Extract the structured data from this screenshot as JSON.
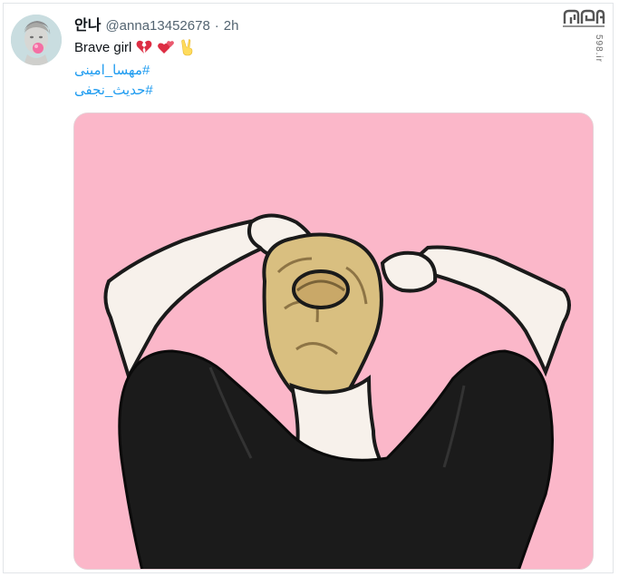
{
  "tweet": {
    "display_name": "안나",
    "handle": "@anna13452678",
    "separator": "·",
    "time": "2h",
    "text": "Brave girl",
    "emojis": [
      "broken-heart",
      "two-hearts",
      "victory-hand"
    ],
    "hashtags": [
      "#مهسا_امینی",
      "#حدیث_نجفی"
    ]
  },
  "watermark": {
    "logo_text": "598",
    "site": "598.ir"
  },
  "media": {
    "description_icon": "girl-tying-hair-illustration"
  }
}
